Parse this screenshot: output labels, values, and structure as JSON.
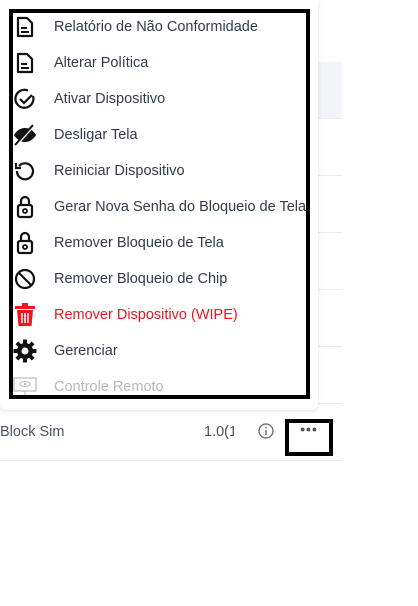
{
  "menu": {
    "items": [
      {
        "label": "Relatório de Não Conformidade",
        "icon": "document-icon"
      },
      {
        "label": "Alterar Política",
        "icon": "document-icon"
      },
      {
        "label": "Ativar Dispositivo",
        "icon": "check-circle-icon"
      },
      {
        "label": "Desligar Tela",
        "icon": "eye-off-icon"
      },
      {
        "label": "Reiniciar Dispositivo",
        "icon": "restart-icon"
      },
      {
        "label": "Gerar Nova Senha do Bloqueio de Tela",
        "icon": "lock-icon"
      },
      {
        "label": "Remover Bloqueio de Tela",
        "icon": "lock-icon"
      },
      {
        "label": "Remover Bloqueio de Chip",
        "icon": "block-icon"
      },
      {
        "label": "Remover Dispositivo (WIPE)",
        "icon": "trash-icon",
        "color": "#f2141e"
      },
      {
        "label": "Gerenciar",
        "icon": "gear-icon"
      },
      {
        "label": "Controle Remoto",
        "icon": "remote-screen-icon",
        "disabled": true
      }
    ]
  },
  "row": {
    "name": "Block Sim",
    "version": "1.0(1",
    "more_label": "•••"
  }
}
